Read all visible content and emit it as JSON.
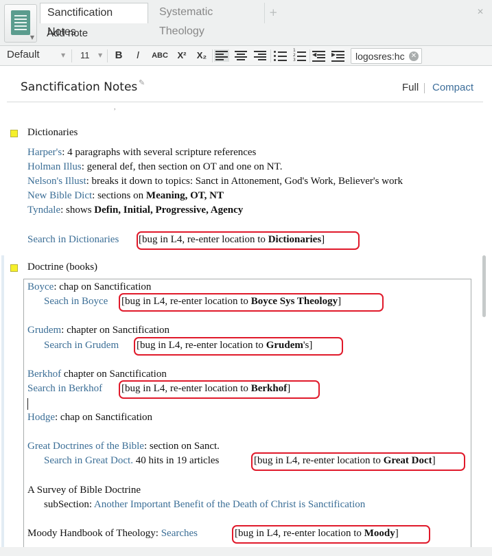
{
  "tabs": {
    "active": "Sanctification Notes",
    "inactive": "Systematic Theology",
    "add": "+",
    "close": "✕"
  },
  "toolbar": {
    "add_note": "Add note",
    "style": "Default",
    "size": "11",
    "bold": "B",
    "italic": "I",
    "smallcaps": "ABC",
    "superscript": "X²",
    "subscript": "X₂",
    "location_value": "logosres:hc",
    "clear": "✕"
  },
  "note": {
    "title": "Sanctification Notes",
    "view_full": "Full",
    "view_compact": "Compact"
  },
  "dictionaries": {
    "heading": "Dictionaries",
    "harpers_link": "Harper's",
    "harpers_text": ":  4 paragraphs with several scripture references",
    "holman_link": "Holman Illus",
    "holman_text": ": general def, then section on OT and one on NT.",
    "nelson_link": "Nelson's Illust",
    "nelson_text": ": breaks it down to topics: Sanct in Attonement, God's Work, Believer's work",
    "newbible_link": "New Bible Dict",
    "newbible_text": ": sections on ",
    "newbible_bold": "Meaning, OT, NT",
    "tyndale_link": "Tyndale",
    "tyndale_text": ":  shows ",
    "tyndale_bold": "Defin, Initial, Progressive, Agency",
    "search_link": "Search in Dictionaries",
    "bug_text": "[bug in L4, re-enter location to ",
    "bug_bold": "Dictionaries",
    "bug_end": "]"
  },
  "doctrine": {
    "heading": "Doctrine (books)",
    "boyce_link": "Boyce",
    "boyce_text": ": chap on Sanctification",
    "boyce_search": "Seach in Boyce",
    "boyce_bug_text": "[bug in L4, re-enter location to ",
    "boyce_bug_bold": "Boyce Sys Theology",
    "boyce_bug_end": "]",
    "grudem_link": "Grudem",
    "grudem_text": ": chapter on Sanctification",
    "grudem_search": "Search in Grudem",
    "grudem_bug_text": "[bug in L4, re-enter location to ",
    "grudem_bug_bold": "Grudem",
    "grudem_bug_end": "'s]",
    "berkhof_link": "Berkhof",
    "berkhof_text": " chapter on Sanctification",
    "berkhof_search": "Search in Berkhof",
    "berkhof_bug_text": "[bug in L4, re-enter location to ",
    "berkhof_bug_bold": "Berkhof",
    "berkhof_bug_end": "]",
    "hodge_link": "Hodge",
    "hodge_text": ": chap on Sanctification",
    "great_link": "Great Doctrines of the Bible",
    "great_text": ": section on Sanct.",
    "great_search": "Search in Great Doct.",
    "great_hits": " 40 hits in 19 articles",
    "great_bug_text": "[bug in L4, re-enter location to ",
    "great_bug_bold": "Great Doct",
    "great_bug_end": "]",
    "survey_title": "A Survey of Bible Doctrine",
    "survey_sub": "subSection: ",
    "survey_link": "Another Important Benefit of the Death of Christ is Sanctification",
    "moody_text": "Moody Handbook of Theology: ",
    "moody_link": "Searches",
    "moody_bug_text": "[bug in L4, re-enter location to ",
    "moody_bug_bold": "Moody",
    "moody_bug_end": "]"
  }
}
